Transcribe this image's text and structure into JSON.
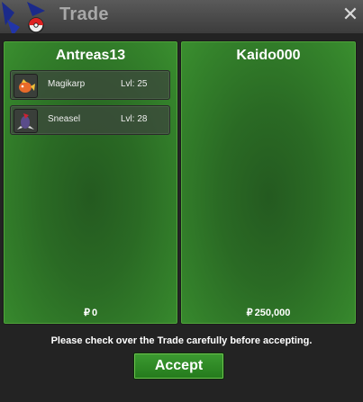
{
  "window": {
    "title": "Trade",
    "close_icon": "close-icon",
    "logo_icon": "pokeball-logo-icon"
  },
  "left_player": {
    "name": "Antreas13",
    "money": "0",
    "currency_symbol": "₽",
    "items": [
      {
        "name": "Magikarp",
        "level": "Lvl: 25",
        "icon": "magikarp-icon"
      },
      {
        "name": "Sneasel",
        "level": "Lvl: 28",
        "icon": "sneasel-icon"
      }
    ]
  },
  "right_player": {
    "name": "Kaido000",
    "money": "250,000",
    "currency_symbol": "₽",
    "items": []
  },
  "notice": "Please check over the Trade carefully before accepting.",
  "accept_label": "Accept",
  "colors": {
    "panel_green": "#2e7426",
    "button_green": "#2f8a27",
    "titlebar": "#4a4a4a"
  }
}
